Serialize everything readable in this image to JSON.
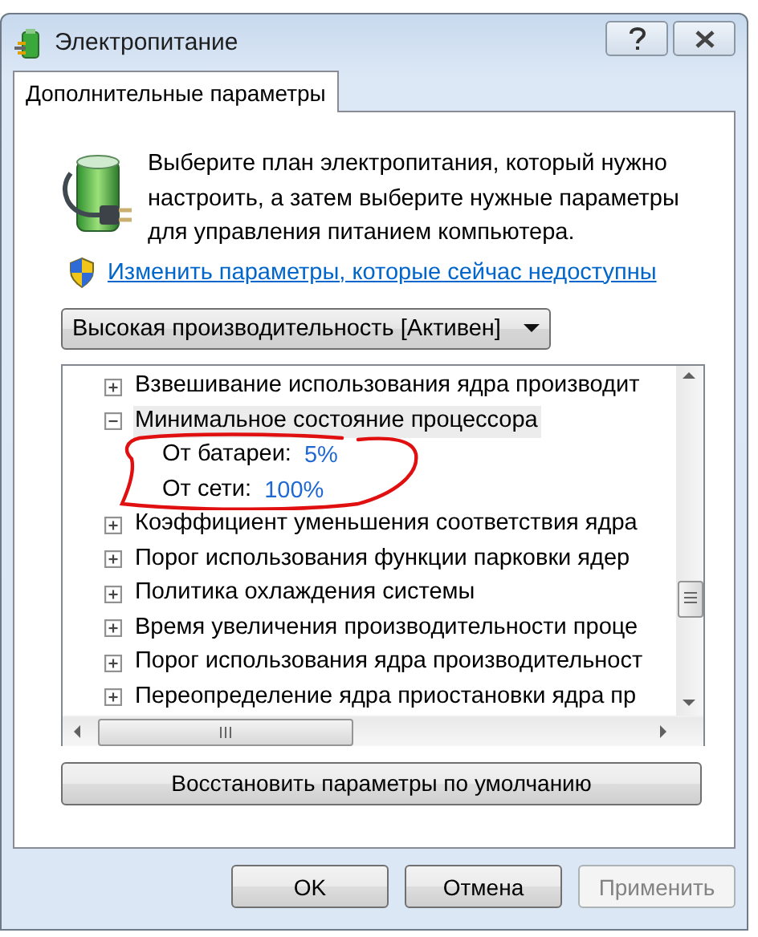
{
  "window": {
    "title": "Электропитание"
  },
  "tabs": [
    {
      "label": "Дополнительные параметры",
      "selected": true
    }
  ],
  "intro": "Выберите план электропитания, который нужно настроить, а затем выберите нужные параметры для управления питанием компьютера.",
  "admin_link": "Изменить параметры, которые сейчас недоступны",
  "plan_dropdown": {
    "value": "Высокая производительность [Активен]"
  },
  "tree": {
    "items": [
      {
        "label": "Взвешивание использования ядра производит",
        "expanded": false,
        "selected": false
      },
      {
        "label": "Минимальное состояние процессора",
        "expanded": true,
        "selected": true,
        "children": [
          {
            "label": "От батареи:",
            "value": "5%",
            "selected": false
          },
          {
            "label": "От сети:",
            "value": "100%",
            "selected": false
          }
        ]
      },
      {
        "label": "Коэффициент уменьшения соответствия ядра",
        "expanded": false,
        "selected": false
      },
      {
        "label": "Порог использования функции парковки ядер",
        "expanded": false,
        "selected": false
      },
      {
        "label": "Политика охлаждения системы",
        "expanded": false,
        "selected": false
      },
      {
        "label": "Время увеличения производительности проце",
        "expanded": false,
        "selected": false
      },
      {
        "label": "Порог использования ядра производительност",
        "expanded": false,
        "selected": false
      },
      {
        "label": "Переопределение ядра приостановки ядра пр",
        "expanded": false,
        "selected": false
      }
    ]
  },
  "restore_button": {
    "label": "Восстановить параметры по умолчанию"
  },
  "buttons": [
    {
      "label": "OK",
      "disabled": false
    },
    {
      "label": "Отмена",
      "disabled": false
    },
    {
      "label": "Применить",
      "disabled": true
    }
  ]
}
